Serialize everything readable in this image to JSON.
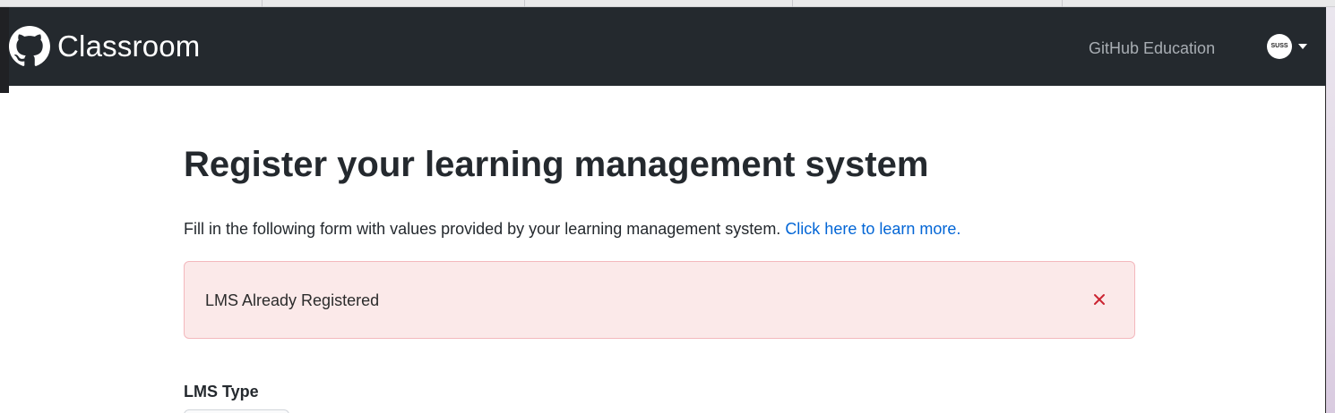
{
  "navbar": {
    "brand_title": "Classroom",
    "nav_link": "GitHub Education",
    "avatar_text": "SUSS",
    "icons": {
      "logo": "github-octocat-icon",
      "caret": "caret-down-icon"
    },
    "bg_color": "#24292e"
  },
  "main": {
    "title": "Register your learning management system",
    "intro_text": "Fill in the following form with values provided by your learning management system. ",
    "intro_link": "Click here to learn more.",
    "alert": {
      "message": "LMS Already Registered",
      "close_icon": "close-icon",
      "bg_color": "#fbe9e9",
      "icon_color": "#cb2431"
    },
    "form": {
      "lms_type_label": "LMS Type"
    }
  }
}
